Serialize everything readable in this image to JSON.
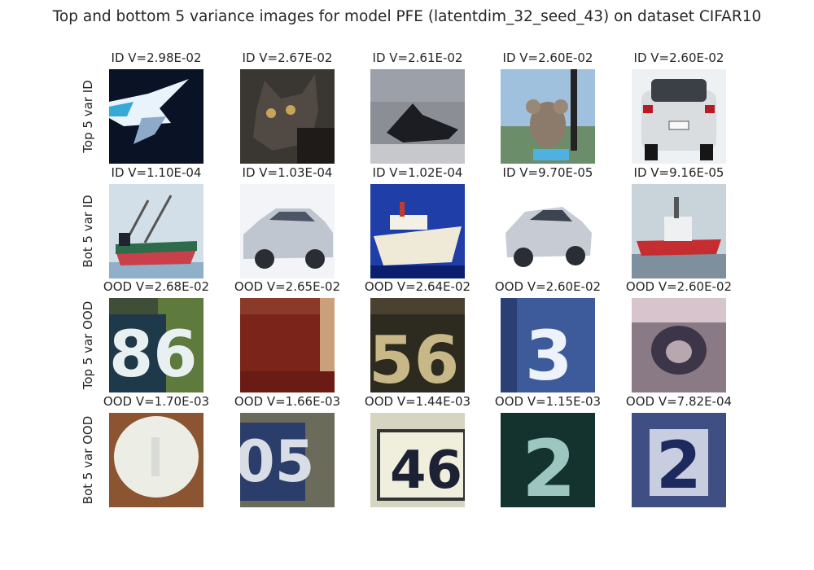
{
  "title": "Top and bottom 5 variance images for model PFE (latentdim_32_seed_43) on dataset CIFAR10",
  "colors": {
    "text": "#262626",
    "background": "#ffffff"
  },
  "chart_data": {
    "type": "image-grid",
    "rows": [
      {
        "label": "Top 5 var ID",
        "cells": [
          {
            "title": "ID V=2.98E-02",
            "variance": 0.0298,
            "image": "airplane-silhouette-dark"
          },
          {
            "title": "ID V=2.67E-02",
            "variance": 0.0267,
            "image": "cat-face-dark"
          },
          {
            "title": "ID V=2.61E-02",
            "variance": 0.0261,
            "image": "jet-fighter-gray"
          },
          {
            "title": "ID V=2.60E-02",
            "variance": 0.026,
            "image": "koala-outdoor"
          },
          {
            "title": "ID V=2.60E-02",
            "variance": 0.026,
            "image": "white-car-rear"
          }
        ]
      },
      {
        "label": "Bot 5 var ID",
        "cells": [
          {
            "title": "ID V=1.10E-04",
            "variance": 0.00011,
            "image": "cargo-ship-green-red"
          },
          {
            "title": "ID V=1.03E-04",
            "variance": 0.000103,
            "image": "silver-sedan"
          },
          {
            "title": "ID V=1.02E-04",
            "variance": 0.000102,
            "image": "white-ship-blue"
          },
          {
            "title": "ID V=9.70E-05",
            "variance": 9.7e-05,
            "image": "silver-car-white"
          },
          {
            "title": "ID V=9.16E-05",
            "variance": 9.16e-05,
            "image": "red-boat"
          }
        ]
      },
      {
        "label": "Top 5 var OOD",
        "cells": [
          {
            "title": "OOD V=2.68E-02",
            "variance": 0.0268,
            "image": "house-number-86"
          },
          {
            "title": "OOD V=2.65E-02",
            "variance": 0.0265,
            "image": "brown-red-blur"
          },
          {
            "title": "OOD V=2.64E-02",
            "variance": 0.0264,
            "image": "house-number-56"
          },
          {
            "title": "OOD V=2.60E-02",
            "variance": 0.026,
            "image": "house-number-3"
          },
          {
            "title": "OOD V=2.60E-02",
            "variance": 0.026,
            "image": "blurry-digit-pink"
          }
        ]
      },
      {
        "label": "Bot 5 var OOD",
        "cells": [
          {
            "title": "OOD V=1.70E-03",
            "variance": 0.0017,
            "image": "white-circle-blur"
          },
          {
            "title": "OOD V=1.66E-03",
            "variance": 0.00166,
            "image": "house-number-05"
          },
          {
            "title": "OOD V=1.44E-03",
            "variance": 0.00144,
            "image": "house-number-46"
          },
          {
            "title": "OOD V=1.15E-03",
            "variance": 0.00115,
            "image": "house-number-2-teal"
          },
          {
            "title": "OOD V=7.82E-04",
            "variance": 0.000782,
            "image": "house-number-2-blue"
          }
        ]
      }
    ]
  }
}
